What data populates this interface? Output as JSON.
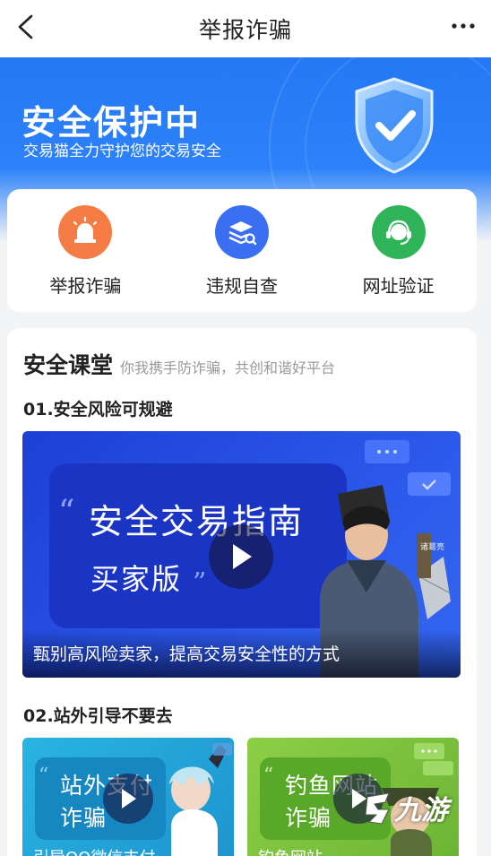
{
  "header": {
    "title": "举报诈骗"
  },
  "hero": {
    "title": "安全保护中",
    "subtitle": "交易猫全力守护您的交易安全"
  },
  "actions": [
    {
      "label": "举报诈骗",
      "icon": "alarm-icon",
      "color": "#f57d45"
    },
    {
      "label": "违规自查",
      "icon": "layers-search-icon",
      "color": "#3a6ff2"
    },
    {
      "label": "网址验证",
      "icon": "headset-icon",
      "color": "#2fb45a"
    }
  ],
  "classroom": {
    "title": "安全课堂",
    "subtitle": "你我携手防诈骗，共创和谐好平台",
    "section1": {
      "label": "01.安全风险可规避",
      "video": {
        "headline": "安全交易指南",
        "subline": "买家版",
        "caption": "甄别高风险卖家，提高交易安全性的方式",
        "seal_text": "诸葛亮"
      }
    },
    "section2": {
      "label": "02.站外引导不要去",
      "videos": [
        {
          "line1": "站外支付",
          "line2": "诈骗",
          "caption": "引导QQ微信支付",
          "color": "#1ea8d8"
        },
        {
          "line1": "钓鱼网站",
          "line2": "诈骗",
          "caption": "钓鱼网站",
          "color": "#7ec23c"
        }
      ]
    }
  },
  "watermark": {
    "text": "九游"
  },
  "colors": {
    "brand_blue": "#2478f4"
  }
}
